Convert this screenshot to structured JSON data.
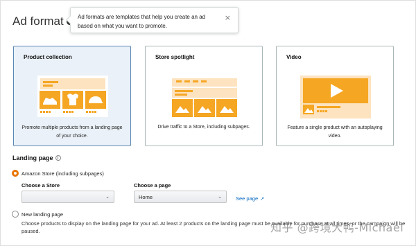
{
  "header": {
    "title": "Ad format",
    "info_icon": "info-icon"
  },
  "tooltip": {
    "text": "Ad formats are templates that help you create an ad based on what you want to promote.",
    "close_glyph": "×"
  },
  "cards": [
    {
      "title": "Product collection",
      "desc": "Promote multiple products from a landing page of your choice.",
      "selected": true
    },
    {
      "title": "Store spotlight",
      "desc": "Drive traffic to a Store, including subpages.",
      "selected": false
    },
    {
      "title": "Video",
      "desc": "Feature a single product with an autoplaying video.",
      "selected": false
    }
  ],
  "landing_page": {
    "label": "Landing page",
    "option_store": "Amazon Store (including subpages)",
    "choose_store_label": "Choose a Store",
    "store_value": "",
    "choose_page_label": "Choose a page",
    "page_value": "Home",
    "see_page": "See page",
    "option_new": "New landing page",
    "new_helper": "Choose products to display on the landing page for your ad. At least 2 products on the landing page must be available for purchase at all times, or the campaign will be paused."
  },
  "watermark": "知乎 @跨境大鸭-Michael",
  "colors": {
    "accent_orange": "#f5a623",
    "selected_border": "#5c87b5",
    "selected_bg": "#eaf1f8",
    "radio_checked": "#e77600",
    "link": "#0066c0"
  }
}
